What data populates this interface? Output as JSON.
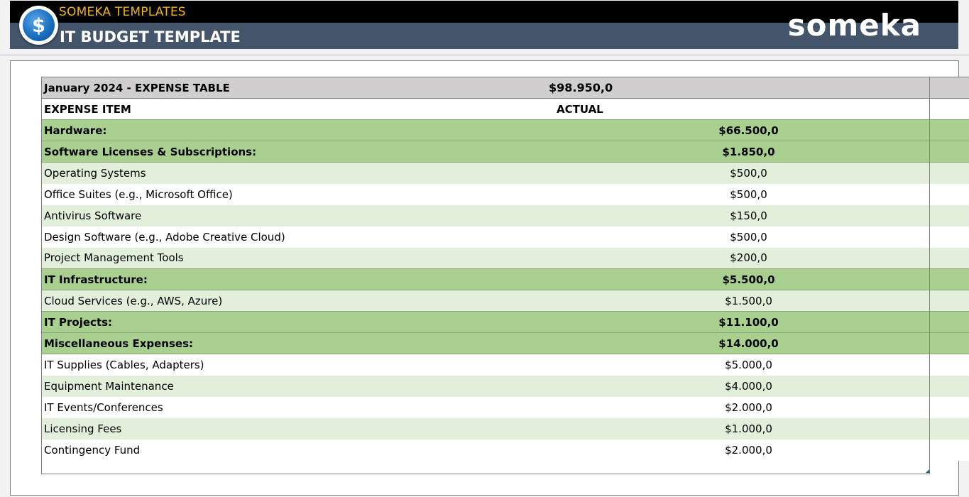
{
  "header": {
    "brand": "SOMEKA TEMPLATES",
    "title": "IT BUDGET TEMPLATE",
    "logo_text": "someka",
    "badge_icon": "dollar-coin-icon"
  },
  "colors": {
    "header_top": "#000000",
    "header_bottom": "#44546a",
    "brand_text": "#f4b400",
    "category_row": "#a9d08e",
    "light_row": "#e2efda",
    "title_row": "#d0cece"
  },
  "table": {
    "title": "January 2024 - EXPENSE TABLE",
    "total": "$98.950,0",
    "col_item": "EXPENSE ITEM",
    "col_actual": "ACTUAL",
    "rows": [
      {
        "type": "category",
        "label": "Hardware:",
        "value": "$66.500,0"
      },
      {
        "type": "category",
        "label": "Software Licenses & Subscriptions:",
        "value": "$1.850,0"
      },
      {
        "type": "light",
        "label": "Operating Systems",
        "value": "$500,0"
      },
      {
        "type": "white",
        "label": "Office Suites (e.g., Microsoft Office)",
        "value": "$500,0"
      },
      {
        "type": "light",
        "label": "Antivirus Software",
        "value": "$150,0"
      },
      {
        "type": "white",
        "label": "Design Software (e.g., Adobe Creative Cloud)",
        "value": "$500,0"
      },
      {
        "type": "light",
        "label": "Project Management Tools",
        "value": "$200,0"
      },
      {
        "type": "category",
        "label": "IT Infrastructure:",
        "value": "$5.500,0"
      },
      {
        "type": "light",
        "label": "Cloud Services (e.g., AWS, Azure)",
        "value": "$1.500,0"
      },
      {
        "type": "category",
        "label": "IT Projects:",
        "value": "$11.100,0"
      },
      {
        "type": "category",
        "label": "Miscellaneous Expenses:",
        "value": "$14.000,0"
      },
      {
        "type": "white",
        "label": "IT Supplies (Cables, Adapters)",
        "value": "$5.000,0"
      },
      {
        "type": "light",
        "label": "Equipment Maintenance",
        "value": "$4.000,0"
      },
      {
        "type": "white",
        "label": "IT Events/Conferences",
        "value": "$2.000,0"
      },
      {
        "type": "light",
        "label": "Licensing Fees",
        "value": "$1.000,0"
      },
      {
        "type": "white",
        "label": "Contingency Fund",
        "value": "$2.000,0"
      }
    ]
  }
}
